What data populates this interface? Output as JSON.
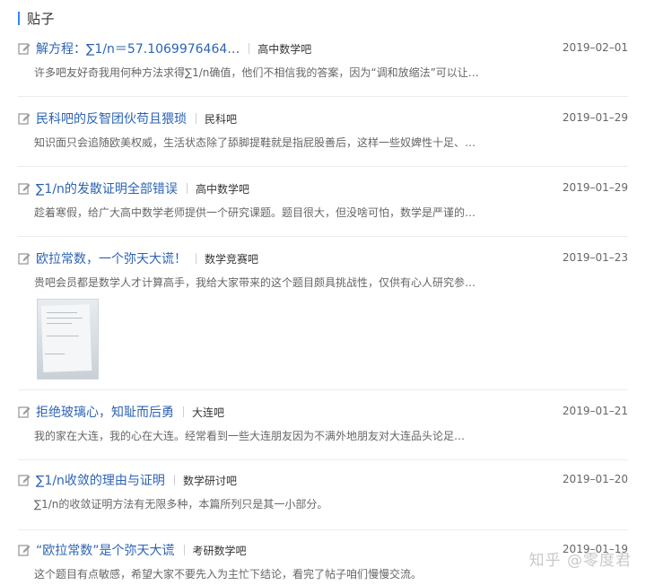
{
  "section": {
    "title": "贴子"
  },
  "posts": [
    {
      "title": "解方程：∑1/n＝57.1069976464…",
      "forum": "高中数学吧",
      "date": "2019–02–01",
      "excerpt": "许多吧友好奇我用何种方法求得∑1/n确值，他们不相信我的答案，因为“调和放缩法”可以让…"
    },
    {
      "title": "民科吧的反智团伙苟且猥琐",
      "forum": "民科吧",
      "date": "2019–01–29",
      "excerpt": "知识面只会追随欧美权威，生活状态除了舔脚提鞋就是指屁股善后，这样一些奴婢性十足、…"
    },
    {
      "title": "∑1/n的发散证明全部错误",
      "forum": "高中数学吧",
      "date": "2019–01–29",
      "excerpt": "趁着寒假，给广大高中数学老师提供一个研究课题。题目很大，但没啥可怕，数学是严谨的…"
    },
    {
      "title": "欧拉常数，一个弥天大谎！",
      "forum": "数学竞赛吧",
      "date": "2019–01–23",
      "excerpt": "贵吧会员都是数学人才计算高手，我给大家带来的这个题目颇具挑战性，仅供有心人研究参…",
      "has_image": true
    },
    {
      "title": "拒绝玻璃心，知耻而后勇",
      "forum": "大连吧",
      "date": "2019–01–21",
      "excerpt": "我的家在大连，我的心在大连。经常看到一些大连朋友因为不满外地朋友对大连品头论足…"
    },
    {
      "title": "∑1/n收敛的理由与证明",
      "forum": "数学研讨吧",
      "date": "2019–01–20",
      "excerpt": "∑1/n的收敛证明方法有无限多种，本篇所列只是其一小部分。"
    },
    {
      "title": "“欧拉常数”是个弥天大谎",
      "forum": "考研数学吧",
      "date": "2019–01–19",
      "excerpt": "这个题目有点敏感，希望大家不要先入为主忙下结论，看完了帖子咱们慢慢交流。"
    }
  ],
  "watermark": "知乎 @零度君",
  "icons": {
    "edit": "edit-icon"
  },
  "colors": {
    "title_link": "#2d64b3",
    "section_accent": "#3385ff"
  }
}
